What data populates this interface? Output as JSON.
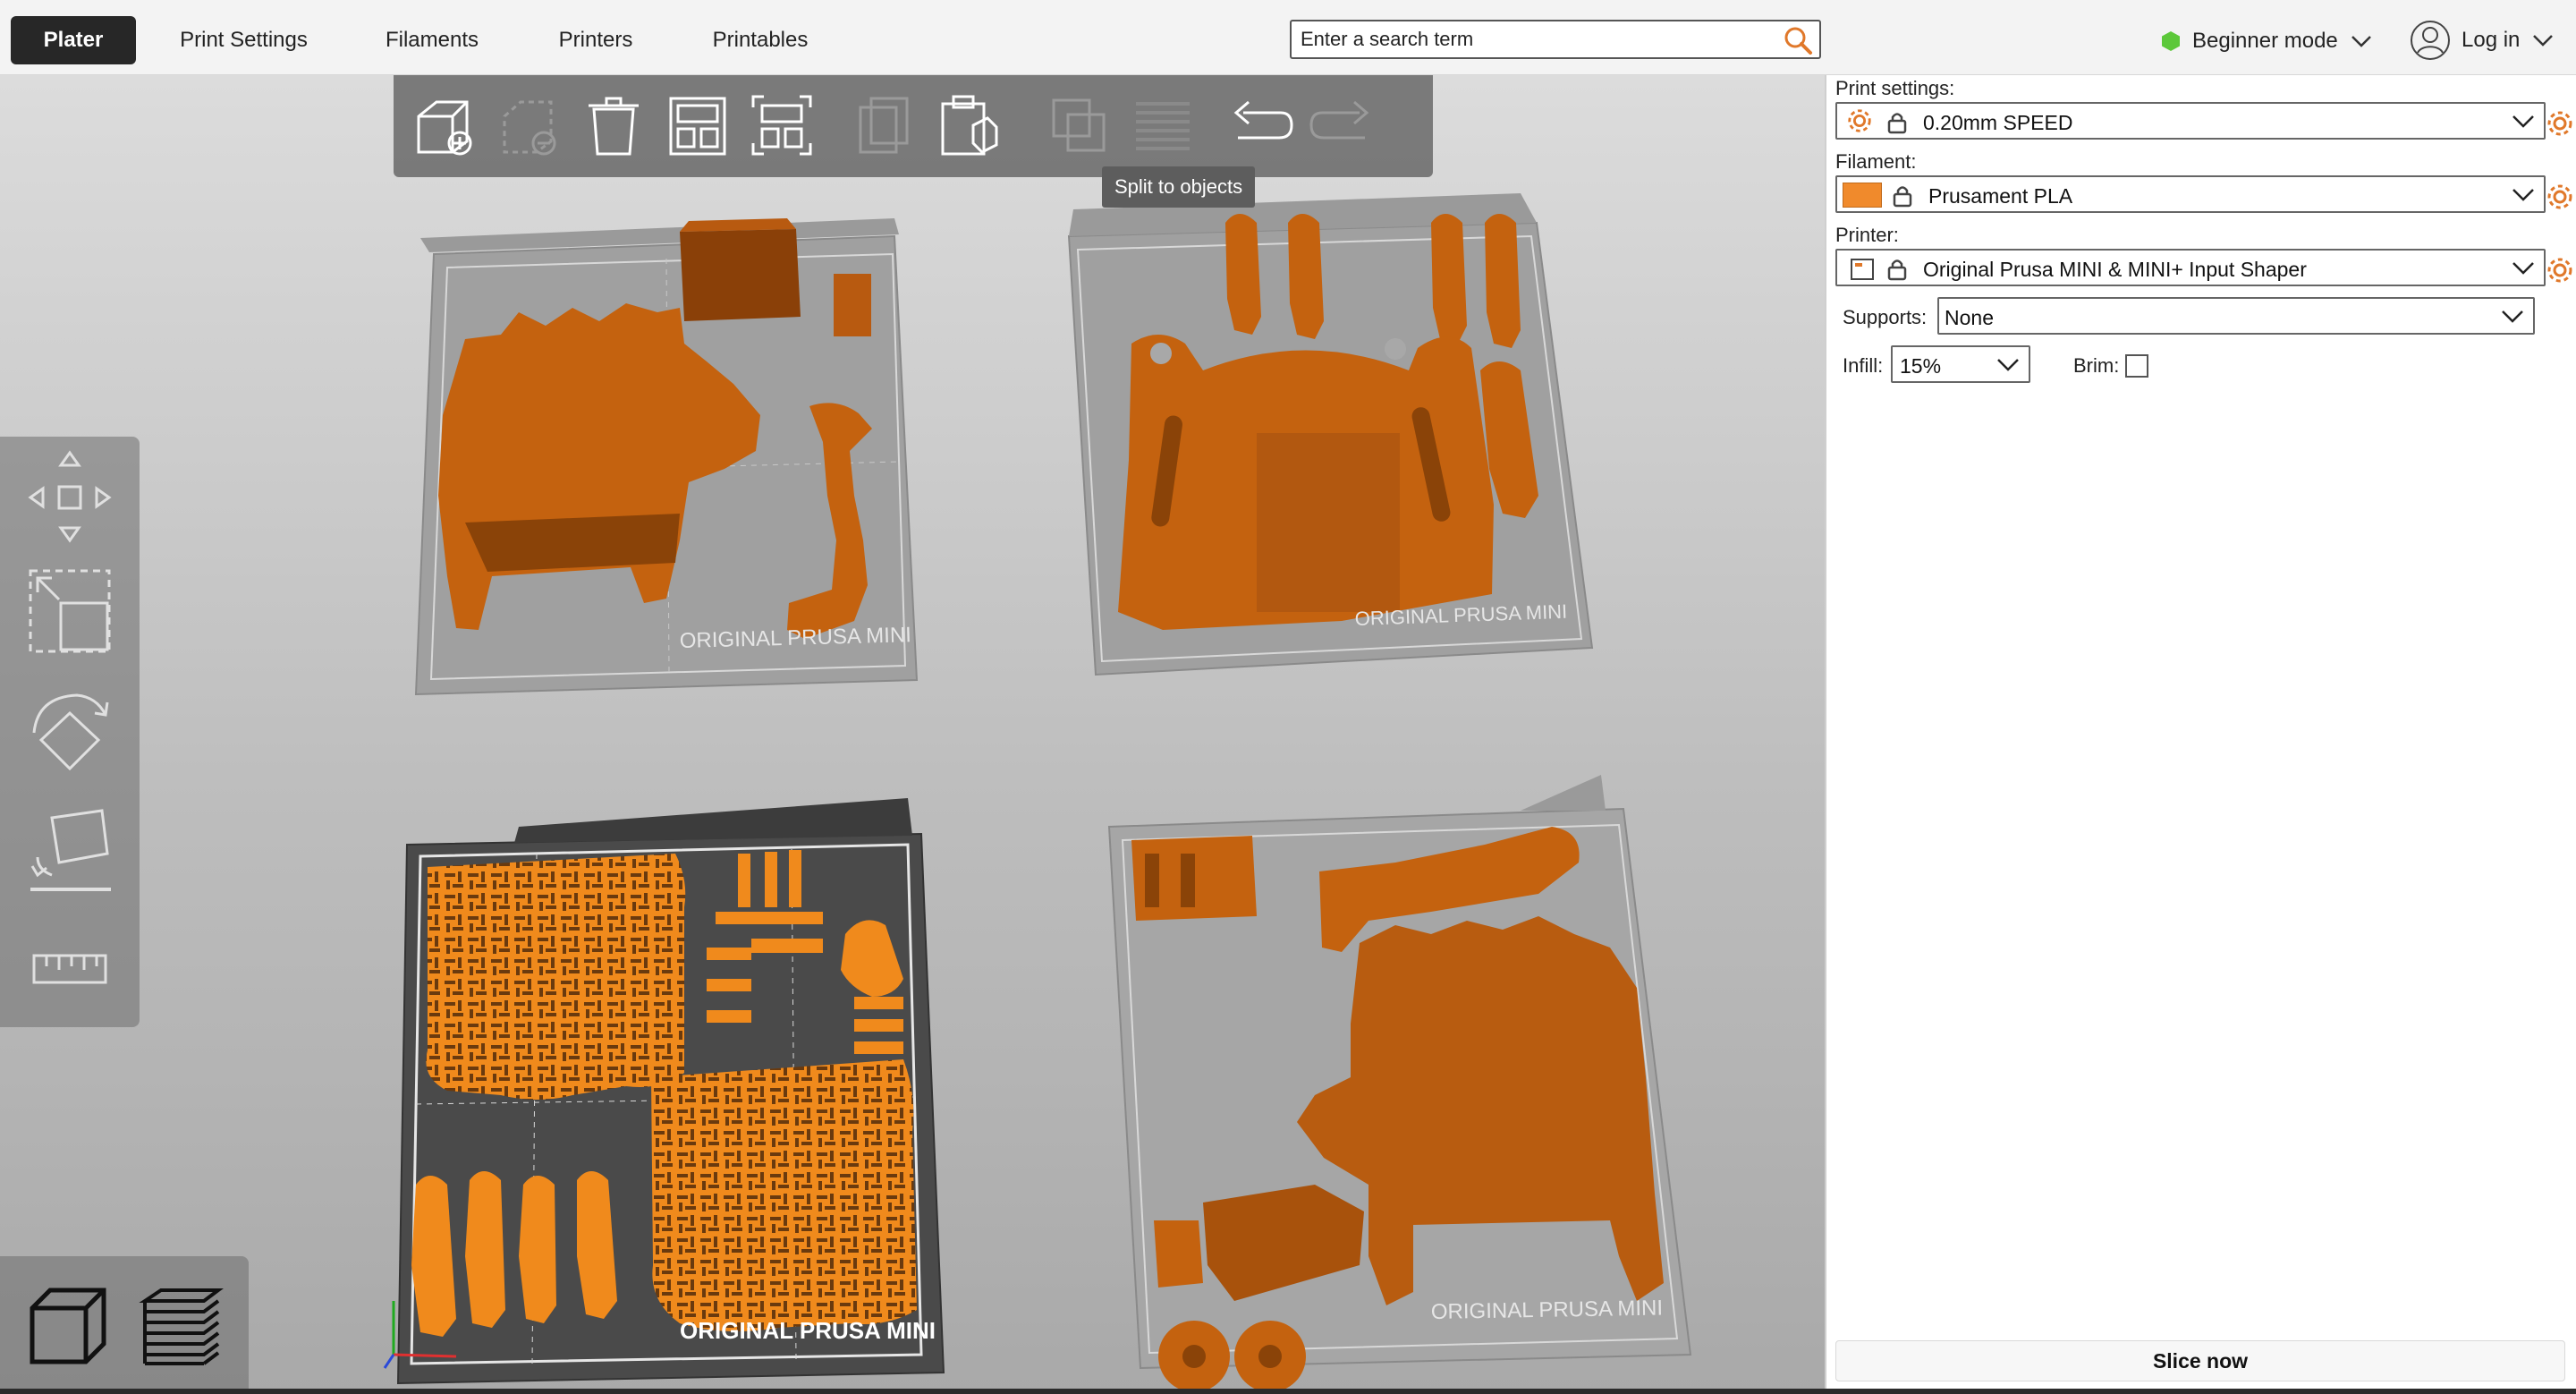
{
  "tabs": [
    {
      "label": "Plater",
      "active": true
    },
    {
      "label": "Print Settings",
      "active": false
    },
    {
      "label": "Filaments",
      "active": false
    },
    {
      "label": "Printers",
      "active": false
    },
    {
      "label": "Printables",
      "active": false
    }
  ],
  "search": {
    "placeholder": "Enter a search term",
    "icon": "search-icon"
  },
  "mode": {
    "label": "Beginner mode",
    "indicator_color": "#5cc83a"
  },
  "account": {
    "label": "Log in"
  },
  "toolbar": {
    "buttons": [
      "add-icon",
      "delete-icon",
      "delete-all-icon",
      "arrange-icon",
      "arrange-selection-icon",
      "copy-icon",
      "paste-icon",
      "split-to-objects-icon",
      "split-to-parts-icon",
      "layers-editing-icon",
      "undo-icon",
      "redo-icon"
    ],
    "tooltip": "Split to objects"
  },
  "left_tools": [
    "move-icon",
    "scale-icon",
    "rotate-icon",
    "place-on-face-icon",
    "measure-icon"
  ],
  "view_tabs": [
    "3d-view-icon",
    "preview-layers-icon"
  ],
  "scene": {
    "bed_label": "ORIGINAL PRUSA MINI",
    "filament_color": "#c86010",
    "selected_color": "#f08a1c"
  },
  "sidebar": {
    "print_settings_label": "Print settings:",
    "print_settings_value": "0.20mm SPEED",
    "filament_label": "Filament:",
    "filament_value": "Prusament PLA",
    "filament_color": "#f08a2c",
    "printer_label": "Printer:",
    "printer_value": "Original Prusa MINI & MINI+ Input Shaper",
    "supports_label": "Supports:",
    "supports_value": "None",
    "infill_label": "Infill:",
    "infill_value": "15%",
    "brim_label": "Brim:",
    "brim_checked": false,
    "slice_label": "Slice now"
  }
}
